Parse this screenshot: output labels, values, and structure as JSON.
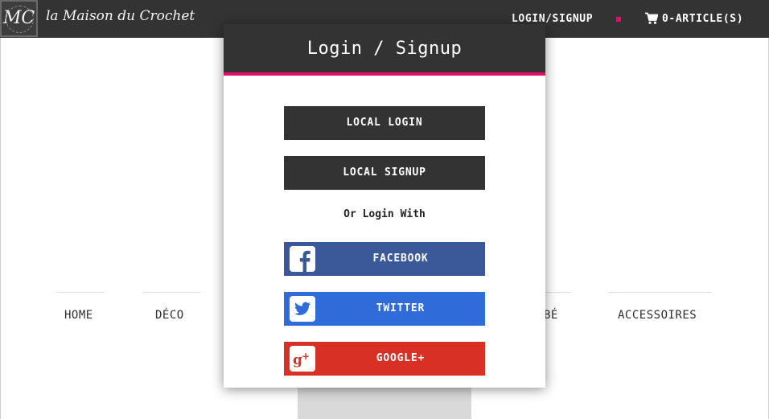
{
  "header": {
    "logo_monogram": "MC",
    "brand_name": "la Maison du Crochet",
    "login_link": "LOGIN/SIGNUP",
    "cart_icon": "shopping-cart-icon",
    "cart_label": "0-ARTICLE(S)",
    "accent_color": "#e0106a"
  },
  "categories": [
    {
      "label": "HOME"
    },
    {
      "label": "DÉCO"
    },
    {
      "label": "BÉ"
    },
    {
      "label": "ACCESSOIRES"
    }
  ],
  "modal": {
    "title": "Login / Signup",
    "local_login": "LOCAL LOGIN",
    "local_signup": "LOCAL SIGNUP",
    "or_text": "Or Login With",
    "social": [
      {
        "label": "FACEBOOK",
        "icon": "facebook-icon",
        "color": "#3b5998"
      },
      {
        "label": "TWITTER",
        "icon": "twitter-icon",
        "color": "#2f6bd9"
      },
      {
        "label": "GOOGLE+",
        "icon": "google-plus-icon",
        "color": "#d93025"
      }
    ]
  }
}
